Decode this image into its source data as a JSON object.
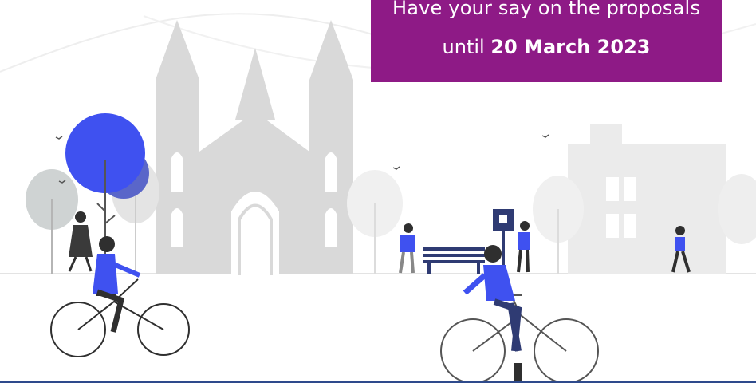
{
  "banner": {
    "line1": "Have your say on the proposals",
    "line2_prefix": "until ",
    "line2_date": "20 March 2023"
  },
  "colors": {
    "banner_bg": "#8e1a86",
    "accent_blue": "#3f51f0",
    "building_grey": "#d9d9d9",
    "bottom_bar": "#2e4a8c"
  },
  "icons": [
    "church-illustration",
    "tree",
    "park-bench",
    "bus-stop-sign",
    "cyclist",
    "pedestrian",
    "bird",
    "building"
  ]
}
